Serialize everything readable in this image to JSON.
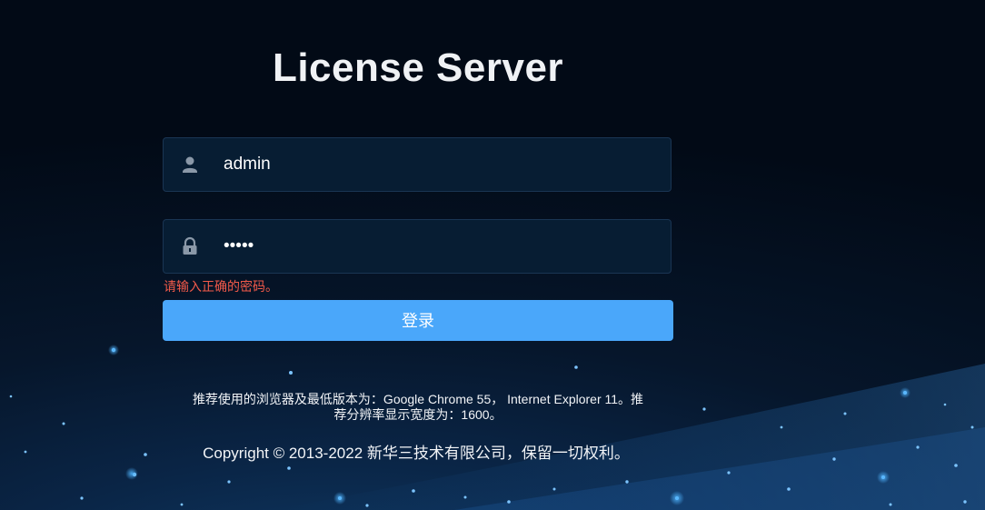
{
  "page": {
    "title": "License Server"
  },
  "login": {
    "username_value": "admin",
    "password_value": "admin",
    "error_message": "请输入正确的密码。",
    "submit_label": "登录"
  },
  "icons": {
    "username": "user-icon",
    "password": "lock-icon"
  },
  "footer": {
    "browser_note": "推荐使用的浏览器及最低版本为：Google Chrome 55， Internet Explorer 11。推荐分辨率显示宽度为：1600。",
    "copyright": "Copyright © 2013-2022 新华三技术有限公司，保留一切权利。"
  },
  "colors": {
    "background": "#020a16",
    "field_background": "#071d33",
    "button": "#4aa7fa",
    "error": "#f25a4a"
  }
}
